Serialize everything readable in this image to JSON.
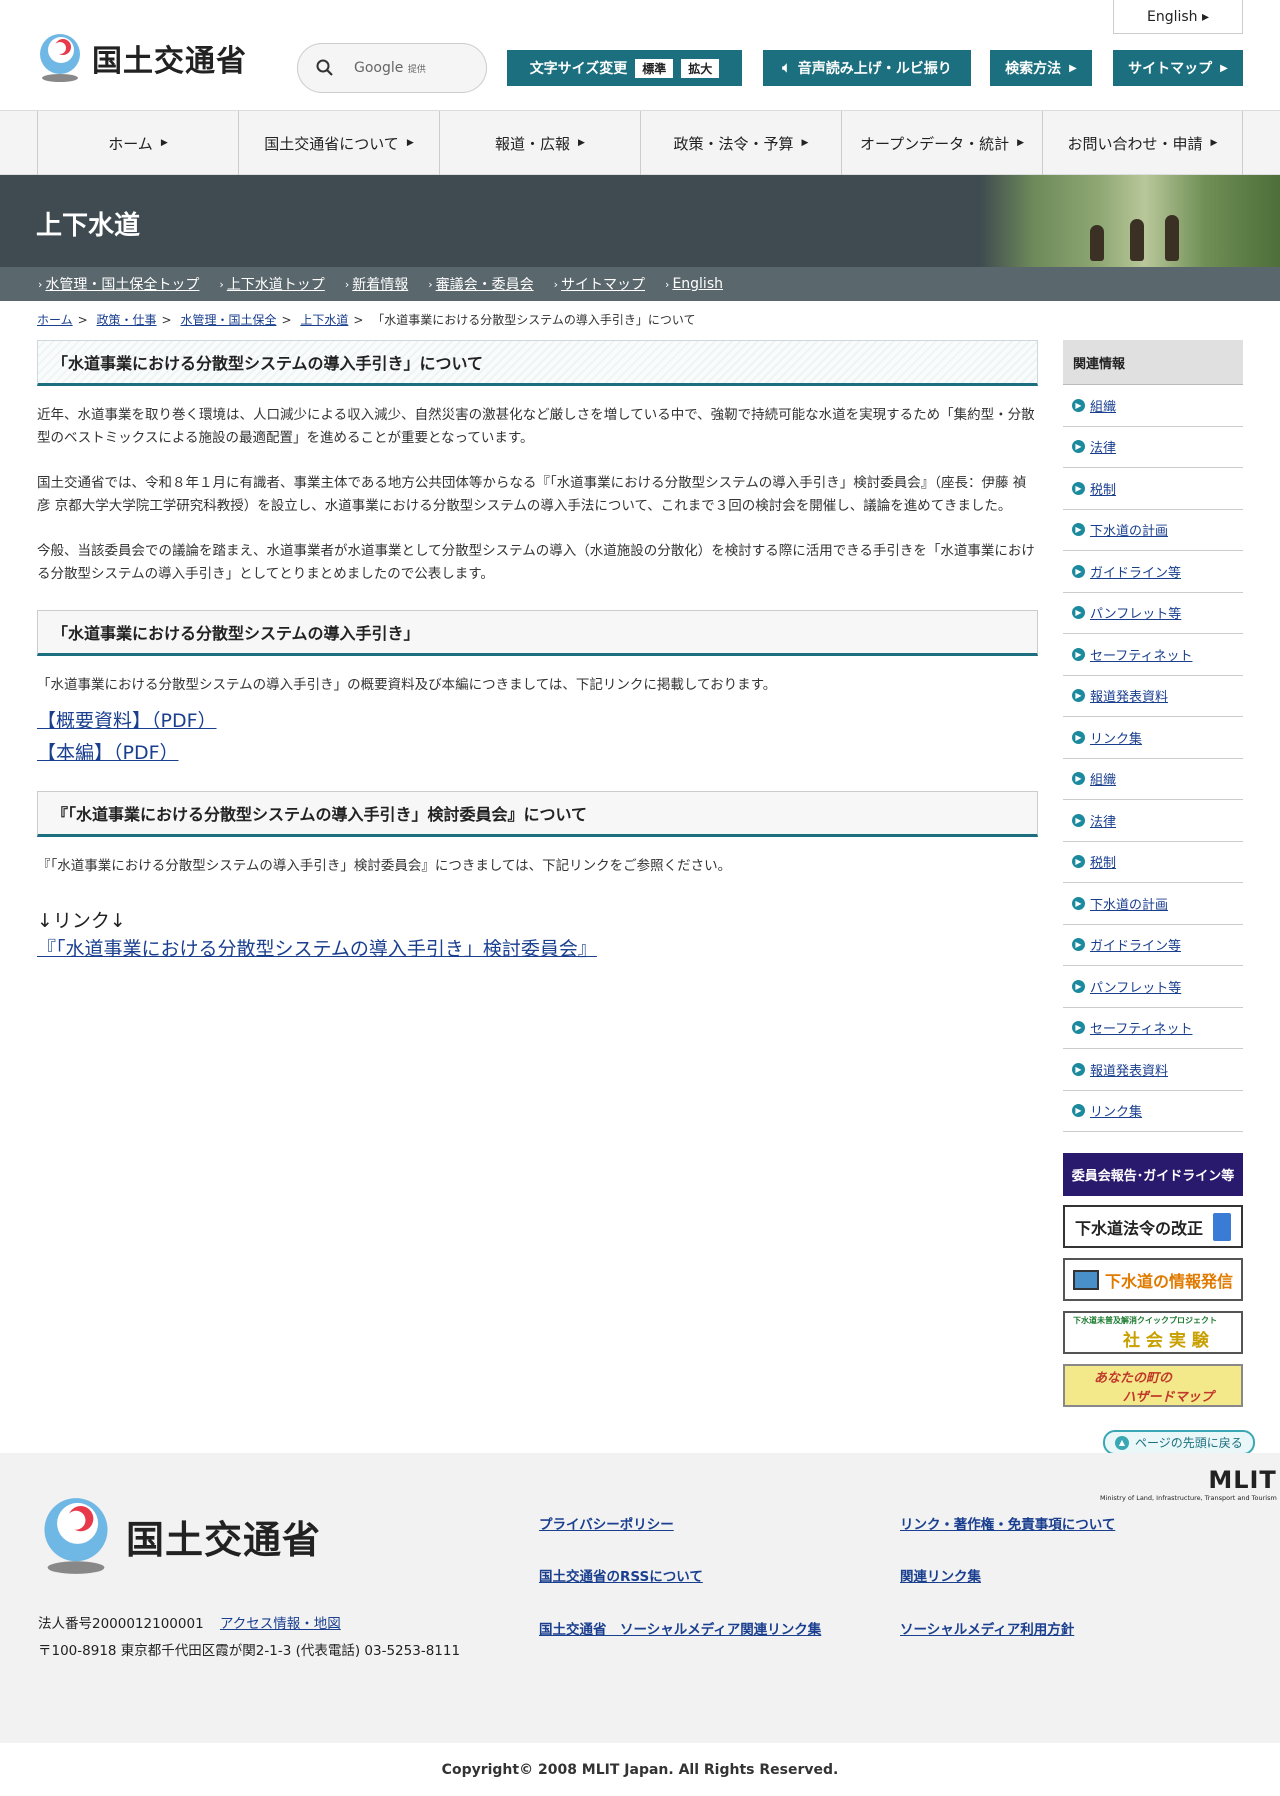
{
  "header": {
    "org_name": "国土交通省",
    "english_label": "English ▸",
    "search_brand": "Google",
    "search_brand_suffix": "提供",
    "font_size_label": "文字サイズ変更",
    "font_size_normal": "標準",
    "font_size_large": "拡大",
    "voice_label": "音声読み上げ・ルビ振り",
    "search_method_label": "検索方法",
    "sitemap_label": "サイトマップ"
  },
  "global_nav": [
    {
      "label": "ホーム"
    },
    {
      "label": "国土交通省について"
    },
    {
      "label": "報道・広報"
    },
    {
      "label": "政策・法令・予算"
    },
    {
      "label": "オープンデータ・統計"
    },
    {
      "label": "お問い合わせ・申請"
    }
  ],
  "section": {
    "title": "上下水道",
    "subnav": [
      {
        "label": "水管理・国土保全トップ"
      },
      {
        "label": "上下水道トップ"
      },
      {
        "label": "新着情報"
      },
      {
        "label": "審議会・委員会"
      },
      {
        "label": "サイトマップ"
      },
      {
        "label": "English"
      }
    ]
  },
  "breadcrumb": {
    "links": [
      "ホーム",
      "政策・仕事",
      "水管理・国土保全",
      "上下水道"
    ],
    "current": "「水道事業における分散型システムの導入手引き」について"
  },
  "main": {
    "title": "「水道事業における分散型システムの導入手引き」について",
    "para1": "近年、水道事業を取り巻く環境は、人口減少による収入減少、自然災害の激甚化など厳しさを増している中で、強靭で持続可能な水道を実現するため「集約型・分散型のベストミックスによる施設の最適配置」を進めることが重要となっています。",
    "para2": "国土交通省では、令和８年１月に有識者、事業主体である地方公共団体等からなる『「水道事業における分散型システムの導入手引き」検討委員会』（座長：伊藤 禎彦 京都大学大学院工学研究科教授）を設立し、水道事業における分散型システムの導入手法について、これまで３回の検討会を開催し、議論を進めてきました。",
    "para3": "今般、当該委員会での議論を踏まえ、水道事業者が水道事業として分散型システムの導入（水道施設の分散化）を検討する際に活用できる手引きを「水道事業における分散型システムの導入手引き」としてとりまとめましたので公表します。",
    "section1_title": "「水道事業における分散型システムの導入手引き」",
    "section1_text": "「水道事業における分散型システムの導入手引き」の概要資料及び本編につきましては、下記リンクに掲載しております。",
    "link_summary": "【概要資料】（PDF）",
    "link_main": "【本編】（PDF）",
    "section2_title": "『「水道事業における分散型システムの導入手引き」検討委員会』について",
    "section2_text": "『「水道事業における分散型システムの導入手引き」検討委員会』につきましては、下記リンクをご参照ください。",
    "link_heading": "↓リンク↓",
    "link_committee": "『「水道事業における分散型システムの導入手引き」検討委員会』"
  },
  "sidebar": {
    "heading": "関連情報",
    "items": [
      {
        "label": "組織"
      },
      {
        "label": "法律"
      },
      {
        "label": "税制"
      },
      {
        "label": "下水道の計画"
      },
      {
        "label": "ガイドライン等"
      },
      {
        "label": "パンフレット等"
      },
      {
        "label": "セーフティネット"
      },
      {
        "label": "報道発表資料"
      },
      {
        "label": "リンク集"
      },
      {
        "label": "組織"
      },
      {
        "label": "法律"
      },
      {
        "label": "税制"
      },
      {
        "label": "下水道の計画"
      },
      {
        "label": "ガイドライン等"
      },
      {
        "label": "パンフレット等"
      },
      {
        "label": "セーフティネット"
      },
      {
        "label": "報道発表資料"
      },
      {
        "label": "リンク集"
      }
    ],
    "banners": {
      "committee": "委員会報告･ガイドライン等",
      "law": "下水道法令の改正",
      "info": "下水道の情報発信",
      "qp_top": "下水道未普及解消クイックプロジェクト",
      "qp_bottom": "社 会 実 験",
      "hazard_top": "あなたの町の",
      "hazard_bottom": "ハザードマップ"
    }
  },
  "page_top": "ページの先頭に戻る",
  "footer": {
    "org_name": "国土交通省",
    "corp_number": "法人番号2000012100001",
    "access_link": "アクセス情報・地図",
    "address": "〒100-8918 東京都千代田区霞が関2-1-3 (代表電話) 03-5253-8111",
    "links": [
      "プライバシーポリシー",
      "リンク・著作権・免責事項について",
      "国土交通省のRSSについて",
      "関連リンク集",
      "国土交通省　ソーシャルメディア関連リンク集",
      "ソーシャルメディア利用方針"
    ],
    "mlit_logo": "MLIT",
    "mlit_sub": "Ministry of Land, Infrastructure, Transport and Tourism",
    "copyright": "Copyright© 2008 MLIT Japan. All Rights Reserved."
  },
  "colors": {
    "accent": "#1b6f7e",
    "banner_bg": "#3f4b50",
    "subnav_bg": "#5a676c",
    "link": "#1a3f8f"
  }
}
